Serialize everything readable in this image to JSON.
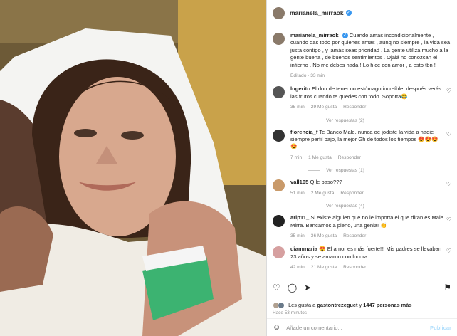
{
  "header": {
    "username": "marianela_mirraok"
  },
  "caption": {
    "username": "marianela_mirraok",
    "text": "Cuando amas incondicionalmente , cuando das todo por quienes amas , aunq no siempre , la vida sea justa contigo , y jamás seas prioridad . La gente utiliza mucho a la gente buena , de buenos sentimientos . Ojalá no conozcan el infierno . No me debes nada ! Lo hice con amor , a esto tbn !",
    "meta": "Editado · 33 min"
  },
  "comments": [
    {
      "user": "lugerito",
      "text": "El don de tener un estómago increíble. después verás las frutos cuando te quedes con todo. Soporta😂",
      "time": "35 min",
      "likes": "29 Me gusta",
      "reply": "Responder",
      "replies": "Ver respuestas (2)"
    },
    {
      "user": "florencia_f",
      "text": "Te Banco Male. nunca oe jodiste la vida a nadie , siempre perfil bajo, la mejor Gh de todos los tiempos 😍😍😍😍",
      "time": "7 min",
      "likes": "1 Me gusta",
      "reply": "Responder",
      "replies": "Ver respuestas (1)"
    },
    {
      "user": "vall105",
      "text": "Q le paso???",
      "time": "51 min",
      "likes": "2 Me gusta",
      "reply": "Responder",
      "replies": "Ver respuestas (4)"
    },
    {
      "user": "arip11_",
      "text": "Si existe alguien que no le importa el que diran es Male Mirra. Bancamos a pleno, una genia! 👏",
      "time": "35 min",
      "likes": "36 Me gusta",
      "reply": "Responder",
      "replies": ""
    },
    {
      "user": "diammaria",
      "text": "😍 El amor es más fuerte!!! Mis padres se llevaban 23 años y se amaron con locura",
      "time": "42 min",
      "likes": "21 Me gusta",
      "reply": "Responder",
      "replies": ""
    }
  ],
  "likes": {
    "prefix": "Les gusta a",
    "user": "gastontrezeguet",
    "joiner": "y",
    "count": "1447 personas más"
  },
  "posted_ago": "Hace 53 minutos",
  "add_comment": {
    "placeholder": "Añade un comentario...",
    "publish": "Publicar"
  }
}
